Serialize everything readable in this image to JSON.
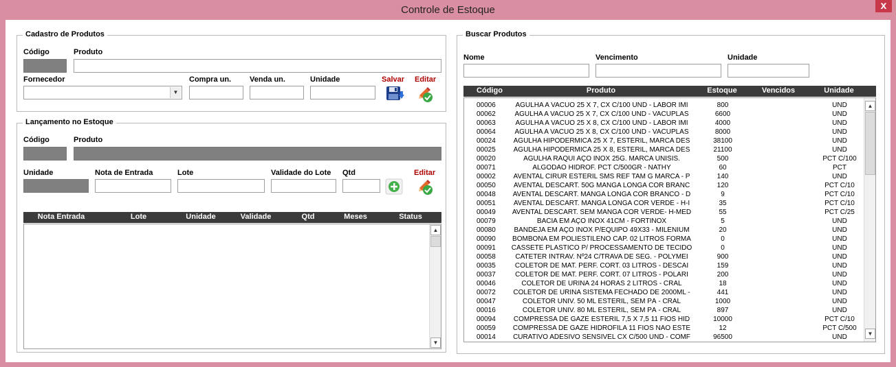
{
  "window": {
    "title": "Controle de Estoque",
    "close_label": "x"
  },
  "cadastro": {
    "group_title": "Cadastro de Produtos",
    "codigo_label": "Código",
    "produto_label": "Produto",
    "fornecedor_label": "Fornecedor",
    "compra_label": "Compra un.",
    "venda_label": "Venda un.",
    "unidade_label": "Unidade",
    "salvar_label": "Salvar",
    "editar_label": "Editar"
  },
  "lancamento": {
    "group_title": "Lançamento no Estoque",
    "codigo_label": "Código",
    "produto_label": "Produto",
    "unidade_label": "Unidade",
    "nota_label": "Nota de Entrada",
    "lote_label": "Lote",
    "validade_label": "Validade do Lote",
    "qtd_label": "Qtd",
    "editar_label": "Editar",
    "columns": [
      "Nota Entrada",
      "Lote",
      "Unidade",
      "Validade",
      "Qtd",
      "Meses",
      "Status"
    ]
  },
  "buscar": {
    "group_title": "Buscar Produtos",
    "nome_label": "Nome",
    "vencimento_label": "Vencimento",
    "unidade_label": "Unidade",
    "columns": [
      "Código",
      "Produto",
      "Estoque",
      "Vencidos",
      "Unidade"
    ],
    "rows": [
      {
        "codigo": "00006",
        "produto": "AGULHA A VACUO 25 X 7, CX C/100 UND - LABOR IMI",
        "estoque": "800",
        "unidade": "UND"
      },
      {
        "codigo": "00062",
        "produto": "AGULHA A VACUO 25 X 7, CX C/100 UND - VACUPLAS",
        "estoque": "6600",
        "unidade": "UND"
      },
      {
        "codigo": "00063",
        "produto": "AGULHA A VACUO 25 X 8, CX C/100 UND - LABOR IMI",
        "estoque": "4000",
        "unidade": "UND"
      },
      {
        "codigo": "00064",
        "produto": "AGULHA A VACUO 25 X 8, CX C/100 UND - VACUPLAS",
        "estoque": "8000",
        "unidade": "UND"
      },
      {
        "codigo": "00024",
        "produto": "AGULHA HIPODERMICA 25 X 7, ESTÉRIL, MARCA DES",
        "estoque": "38100",
        "unidade": "UND"
      },
      {
        "codigo": "00025",
        "produto": "AGULHA HIPODERMICA 25 X 8, ESTÉRIL, MARCA DES",
        "estoque": "21100",
        "unidade": "UND"
      },
      {
        "codigo": "00020",
        "produto": "AGULHA RAQUI AÇO INOX 25G. MARCA UNISIS.",
        "estoque": "500",
        "unidade": "PCT C/100"
      },
      {
        "codigo": "00071",
        "produto": "ALGODÃO HIDROF. PCT C/500GR - NATHY",
        "estoque": "60",
        "unidade": "PCT"
      },
      {
        "codigo": "00002",
        "produto": "AVENTAL CIRUR ESTERIL SMS REF TAM G MARCA - P",
        "estoque": "140",
        "unidade": "UND"
      },
      {
        "codigo": "00050",
        "produto": "AVENTAL DESCART. 50G MANGA LONGA COR BRANC",
        "estoque": "120",
        "unidade": "PCT C/10"
      },
      {
        "codigo": "00048",
        "produto": "AVENTAL DESCART. MANGA LONGA COR BRANCO - D",
        "estoque": "9",
        "unidade": "PCT C/10"
      },
      {
        "codigo": "00051",
        "produto": "AVENTAL DESCART. MANGA LONGA COR VERDE - H-I",
        "estoque": "35",
        "unidade": "PCT C/10"
      },
      {
        "codigo": "00049",
        "produto": "AVENTAL DESCART. SEM MANGA COR VERDE- H-MED",
        "estoque": "55",
        "unidade": "PCT C/25"
      },
      {
        "codigo": "00079",
        "produto": "BACIA EM AÇO INOX 41CM - FORTINOX",
        "estoque": "5",
        "unidade": "UND"
      },
      {
        "codigo": "00080",
        "produto": "BANDEJA EM AÇO INOX P/EQUIPO 49X33 - MILENIUM",
        "estoque": "20",
        "unidade": "UND"
      },
      {
        "codigo": "00090",
        "produto": "BOMBONA EM POLIESTILENO CAP. 02 LITROS FORMA",
        "estoque": "0",
        "unidade": "UND"
      },
      {
        "codigo": "00091",
        "produto": "CASSETE PLASTICO P/ PROCESSAMENTO DE TECIDO",
        "estoque": "0",
        "unidade": "UND"
      },
      {
        "codigo": "00058",
        "produto": "CATETER INTRAV. Nº24 C/TRAVA DE SEG. - POLYMEI",
        "estoque": "900",
        "unidade": "UND"
      },
      {
        "codigo": "00035",
        "produto": "COLETOR DE MAT. PERF. CORT. 03 LITROS - DESCAI",
        "estoque": "159",
        "unidade": "UND"
      },
      {
        "codigo": "00037",
        "produto": "COLETOR DE MAT. PERF. CORT. 07 LITROS - POLARI",
        "estoque": "200",
        "unidade": "UND"
      },
      {
        "codigo": "00046",
        "produto": "COLETOR DE URINA 24 HORAS 2 LITROS - CRAL",
        "estoque": "18",
        "unidade": "UND"
      },
      {
        "codigo": "00072",
        "produto": "COLETOR DE URINA SISTEMA FECHADO DE 2000ML -",
        "estoque": "441",
        "unidade": "UND"
      },
      {
        "codigo": "00047",
        "produto": "COLETOR UNIV. 50 ML ESTERIL, SEM PÁ - CRAL",
        "estoque": "1000",
        "unidade": "UND"
      },
      {
        "codigo": "00016",
        "produto": "COLETOR UNIV. 80 ML ESTERIL, SEM PÁ - CRAL",
        "estoque": "897",
        "unidade": "UND"
      },
      {
        "codigo": "00094",
        "produto": "COMPRESSA DE GAZE ESTERIL 7,5 X 7,5 11 FIOS HID",
        "estoque": "10000",
        "unidade": "PCT C/10"
      },
      {
        "codigo": "00059",
        "produto": "COMPRESSA DE GAZE HIDROFILA 11 FIOS NÃO ESTE",
        "estoque": "12",
        "unidade": "PCT C/500"
      },
      {
        "codigo": "00014",
        "produto": "CURATIVO ADESIVO SENSIVEL CX C/500 UND - COMF",
        "estoque": "96500",
        "unidade": "UND"
      }
    ]
  },
  "icons": {
    "save": "floppy-disk-icon",
    "edit": "edit-pencil-icon",
    "add": "add-plus-icon"
  }
}
